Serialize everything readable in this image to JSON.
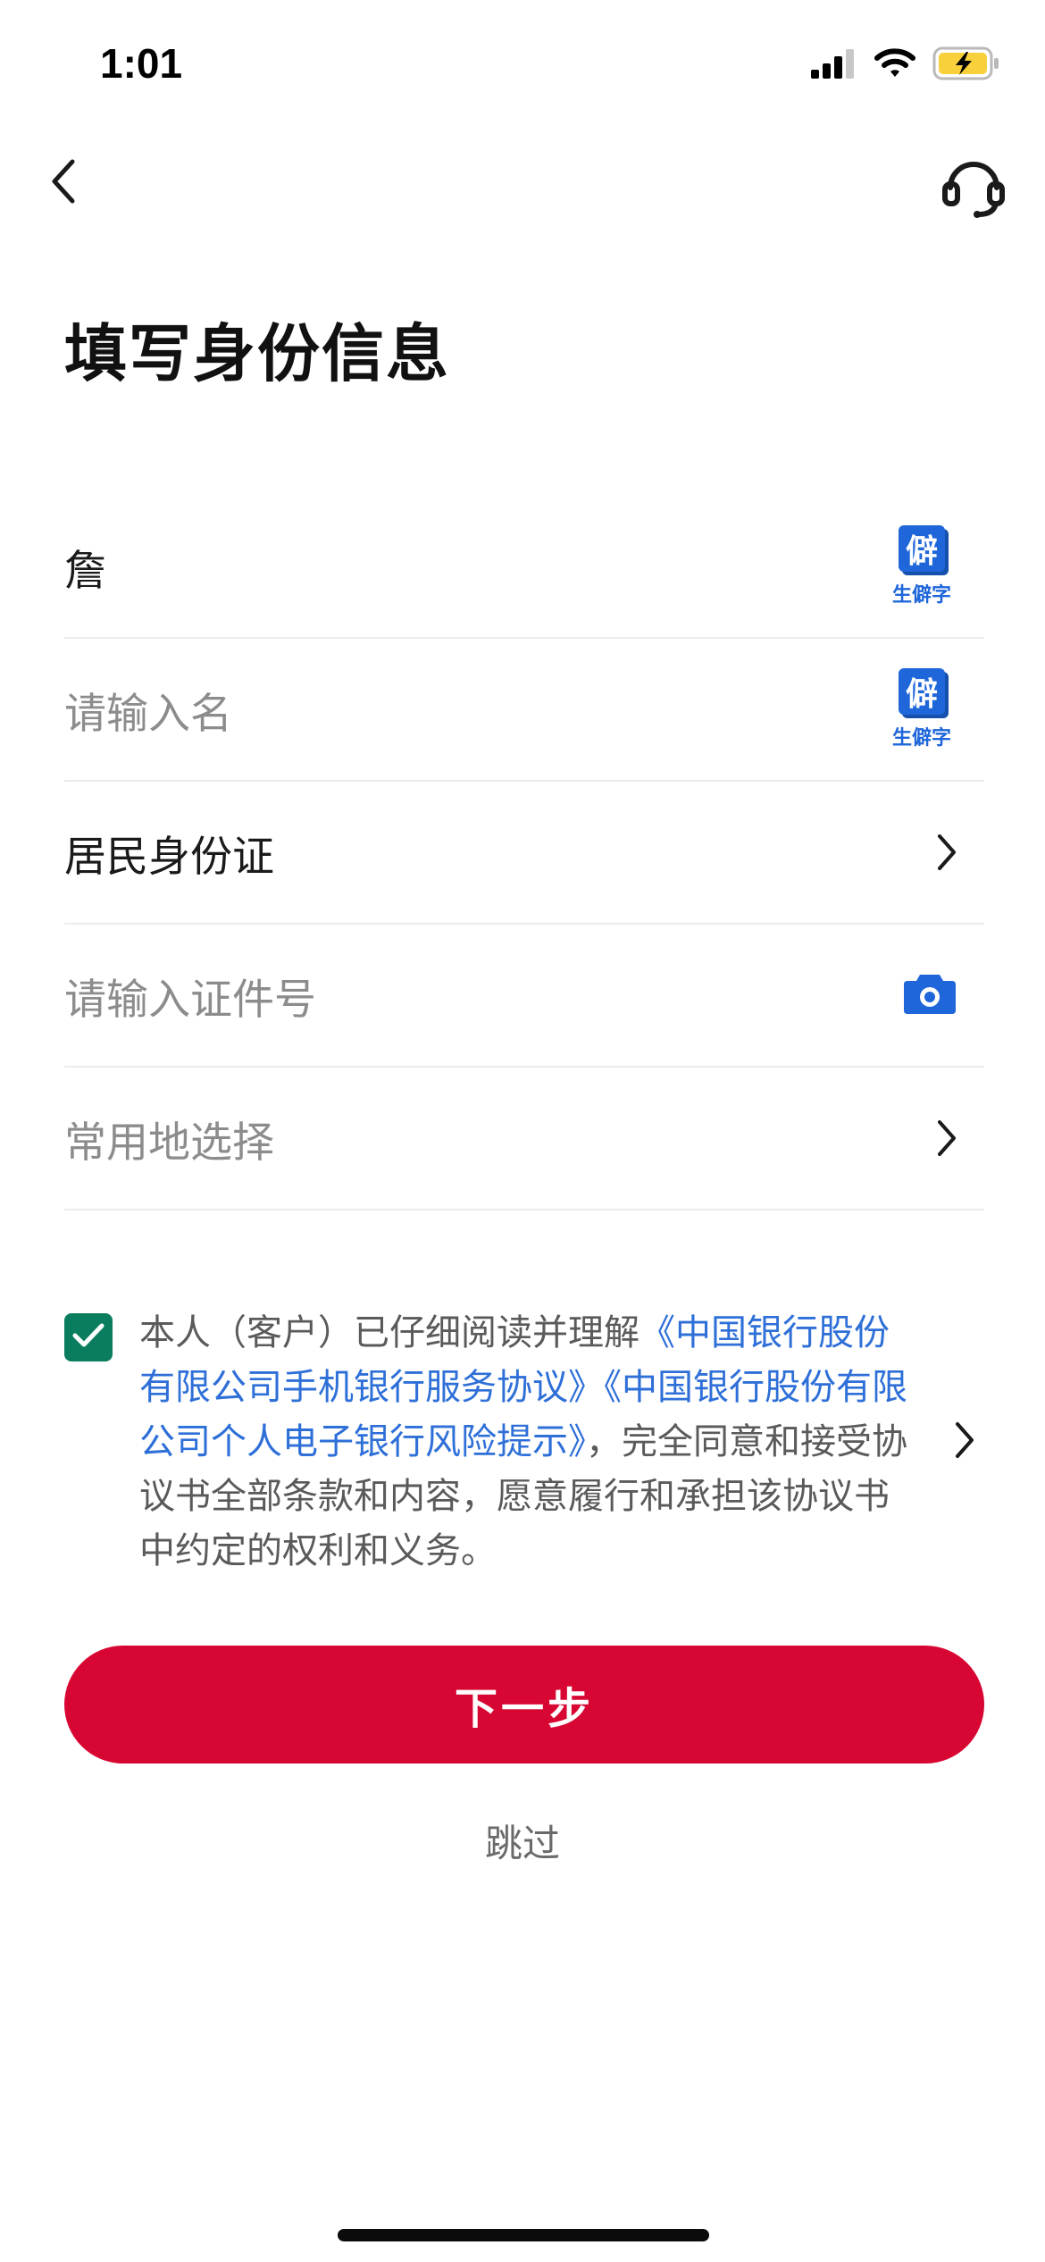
{
  "status_bar": {
    "time": "1:01"
  },
  "page": {
    "title": "填写身份信息"
  },
  "form": {
    "surname": {
      "value": "詹",
      "rare_char_icon": "僻",
      "rare_char_label": "生僻字"
    },
    "given_name": {
      "placeholder": "请输入名",
      "rare_char_icon": "僻",
      "rare_char_label": "生僻字"
    },
    "id_type": {
      "value": "居民身份证"
    },
    "id_number": {
      "placeholder": "请输入证件号"
    },
    "region": {
      "placeholder": "常用地选择"
    }
  },
  "agreement": {
    "checked": true,
    "text_prefix": "本人（客户）已仔细阅读并理解",
    "link_1": "《中国银行股份有限公司手机银行服务协议》",
    "link_2": "《中国银行股份有限公司个人电子银行风险提示》",
    "text_suffix": "，完全同意和接受协议书全部条款和内容，愿意履行和承担该协议书中约定的权利和义务。"
  },
  "actions": {
    "next_label": "下一步",
    "skip_label": "跳过"
  },
  "colors": {
    "primary": "#d80633",
    "link": "#2e6fd8",
    "icon_blue": "#1e66d9",
    "checkbox": "#0a7d5e",
    "battery_fill": "#f7d03c"
  },
  "icons": {
    "back": "chevron-left-icon",
    "service": "headset-icon",
    "chevron": "chevron-right-icon",
    "camera": "camera-icon",
    "check": "check-icon"
  }
}
